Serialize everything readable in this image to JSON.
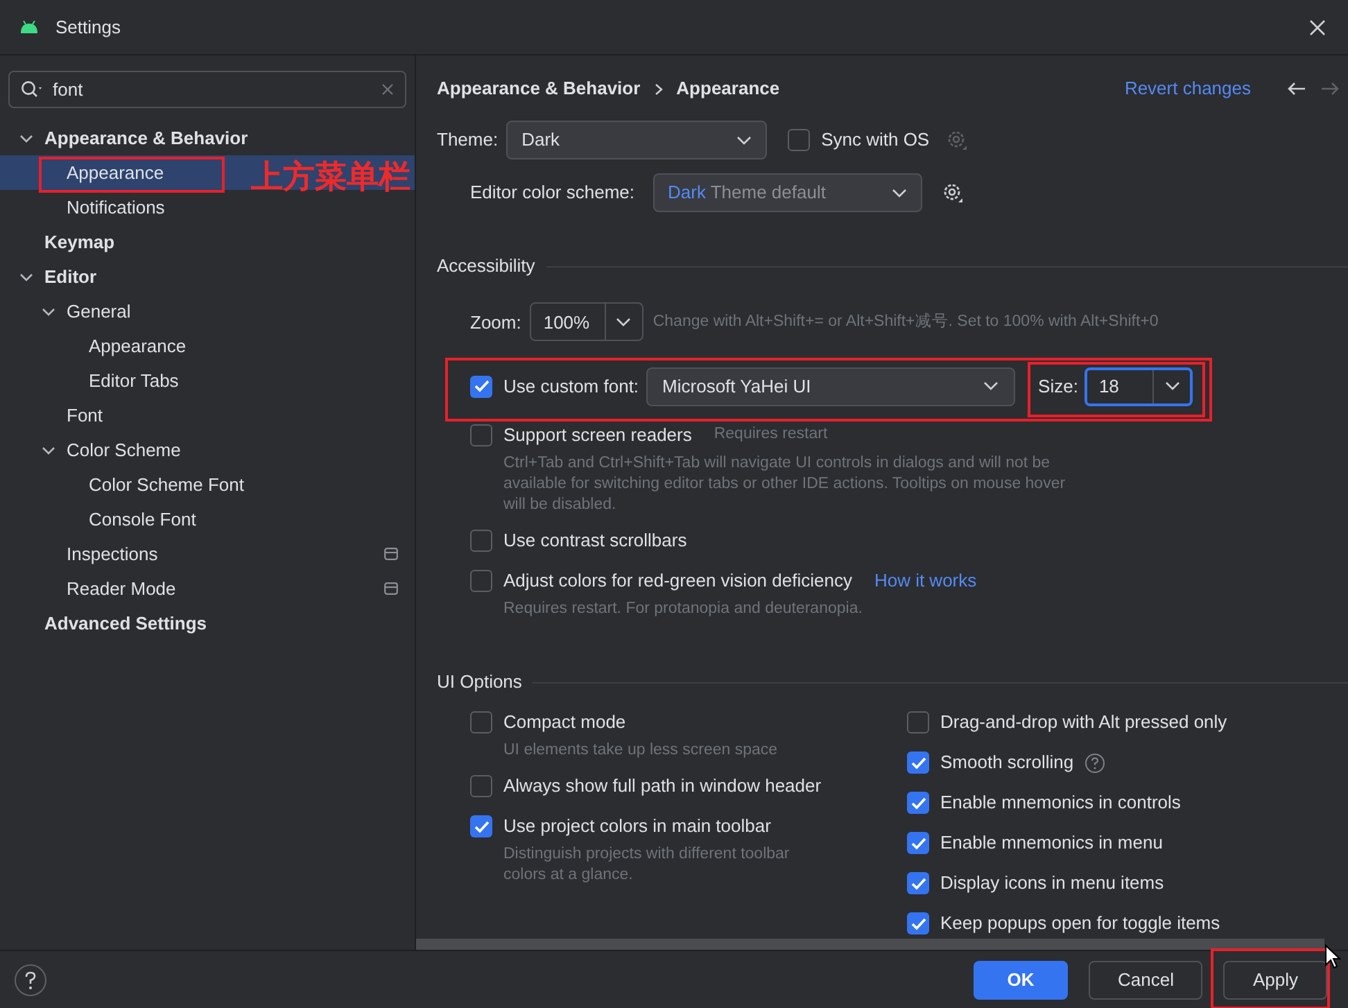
{
  "window": {
    "title": "Settings"
  },
  "search": {
    "value": "font"
  },
  "tree": [
    {
      "label": "Appearance & Behavior",
      "expanded": true,
      "selected": false,
      "children": [
        {
          "label": "Appearance",
          "selected": true,
          "highlighted": true
        },
        {
          "label": "Notifications",
          "selected": false
        }
      ]
    },
    {
      "label": "Keymap",
      "selected": false
    },
    {
      "label": "Editor",
      "expanded": true,
      "selected": false,
      "children": [
        {
          "label": "General",
          "expanded": true,
          "selected": false,
          "children": [
            {
              "label": "Appearance",
              "selected": false
            },
            {
              "label": "Editor Tabs",
              "selected": false
            }
          ]
        },
        {
          "label": "Font",
          "selected": false
        },
        {
          "label": "Color Scheme",
          "expanded": true,
          "selected": false,
          "children": [
            {
              "label": "Color Scheme Font",
              "selected": false
            },
            {
              "label": "Console Font",
              "selected": false
            }
          ]
        },
        {
          "label": "Inspections",
          "selected": false,
          "project_scope": true
        },
        {
          "label": "Reader Mode",
          "selected": false,
          "project_scope": true
        }
      ]
    },
    {
      "label": "Advanced Settings",
      "selected": false
    }
  ],
  "annotation": {
    "text": "上方菜单栏"
  },
  "breadcrumb": [
    "Appearance & Behavior",
    "Appearance"
  ],
  "revert": "Revert changes",
  "theme": {
    "label": "Theme:",
    "value": "Dark",
    "sync": {
      "label": "Sync with OS",
      "checked": false
    }
  },
  "editor_scheme": {
    "label": "Editor color scheme:",
    "value_accent": "Dark",
    "value_rest": "Theme default"
  },
  "accessibility": {
    "title": "Accessibility",
    "zoom": {
      "label": "Zoom:",
      "value": "100%",
      "hint": "Change with Alt+Shift+= or Alt+Shift+减号. Set to 100% with Alt+Shift+0"
    },
    "custom_font": {
      "label": "Use custom font:",
      "checked": true,
      "value": "Microsoft YaHei UI",
      "size_label": "Size:",
      "size": "18",
      "size_focused": true,
      "highlighted": true
    },
    "options": [
      {
        "label": "Support screen readers",
        "checked": false,
        "note": "Requires restart",
        "description": "Ctrl+Tab and Ctrl+Shift+Tab will navigate UI controls in dialogs and will not be available for switching editor tabs or other IDE actions. Tooltips on mouse hover will be disabled."
      },
      {
        "label": "Use contrast scrollbars",
        "checked": false
      },
      {
        "label": "Adjust colors for red-green vision deficiency",
        "checked": false,
        "link": "How it works",
        "description": "Requires restart. For protanopia and deuteranopia."
      }
    ]
  },
  "ui_options": {
    "title": "UI Options",
    "left": [
      {
        "label": "Compact mode",
        "checked": false,
        "description": "UI elements take up less screen space"
      },
      {
        "label": "Always show full path in window header",
        "checked": false
      },
      {
        "label": "Use project colors in main toolbar",
        "checked": true,
        "description": "Distinguish projects with different toolbar colors at a glance."
      }
    ],
    "right": [
      {
        "label": "Drag-and-drop with Alt pressed only",
        "checked": false
      },
      {
        "label": "Smooth scrolling",
        "checked": true,
        "help": true
      },
      {
        "label": "Enable mnemonics in controls",
        "checked": true
      },
      {
        "label": "Enable mnemonics in menu",
        "checked": true
      },
      {
        "label": "Display icons in menu items",
        "checked": true
      },
      {
        "label": "Keep popups open for toggle items",
        "checked": true
      }
    ]
  },
  "footer": {
    "buttons": [
      {
        "label": "OK",
        "kind": "primary"
      },
      {
        "label": "Cancel",
        "kind": "secondary"
      },
      {
        "label": "Apply",
        "kind": "secondary",
        "highlighted": true
      }
    ]
  }
}
